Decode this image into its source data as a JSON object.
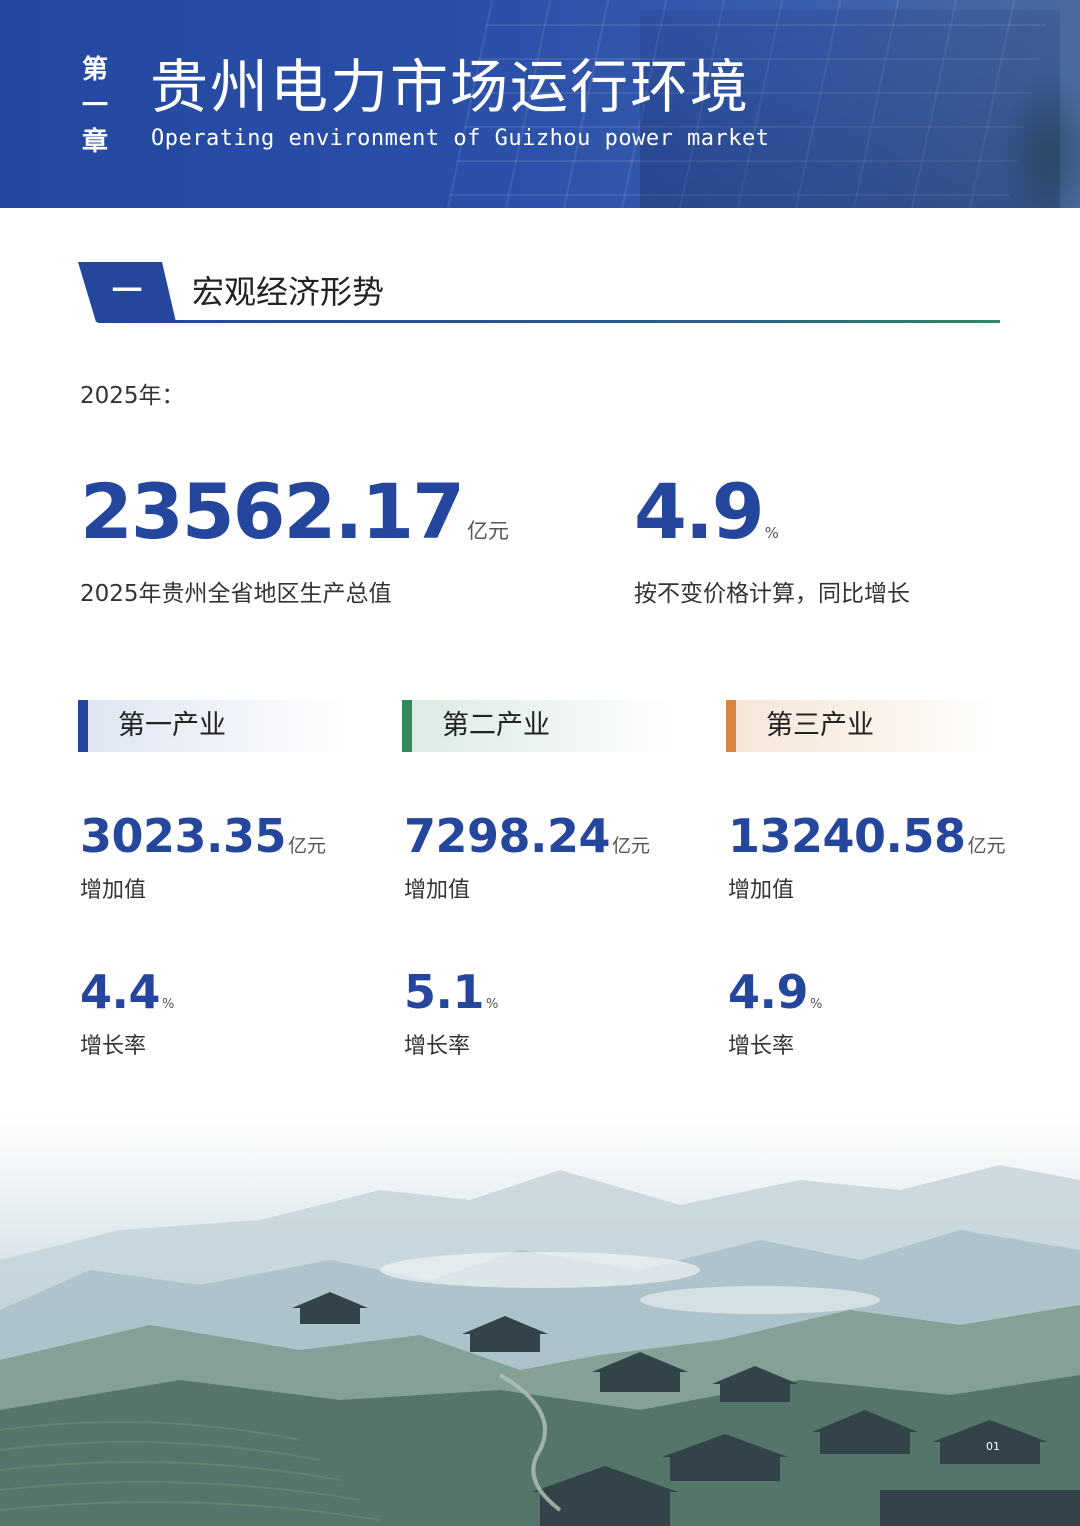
{
  "banner": {
    "chapter_chars": [
      "第",
      "一",
      "章"
    ],
    "title": "贵州电力市场运行环境",
    "subtitle": "Operating environment of Guizhou power market"
  },
  "section": {
    "number": "一",
    "title": "宏观经济形势"
  },
  "year_label": "2025年：",
  "gdp": {
    "value": "23562.17",
    "unit": "亿元",
    "caption": "2025年贵州全省地区生产总值"
  },
  "growth": {
    "value": "4.9",
    "unit": "%",
    "caption": "按不变价格计算，同比增长"
  },
  "industries": [
    {
      "label": "第一产业",
      "value": "3023.35",
      "unit": "亿元",
      "value_label": "增加值",
      "rate": "4.4",
      "rate_unit": "%",
      "rate_label": "增长率",
      "color": "#24469c"
    },
    {
      "label": "第二产业",
      "value": "7298.24",
      "unit": "亿元",
      "value_label": "增加值",
      "rate": "5.1",
      "rate_unit": "%",
      "rate_label": "增长率",
      "color": "#2e8a5a"
    },
    {
      "label": "第三产业",
      "value": "13240.58",
      "unit": "亿元",
      "value_label": "增加值",
      "rate": "4.9",
      "rate_unit": "%",
      "rate_label": "增长率",
      "color": "#d9833f"
    }
  ],
  "page_number": "01"
}
